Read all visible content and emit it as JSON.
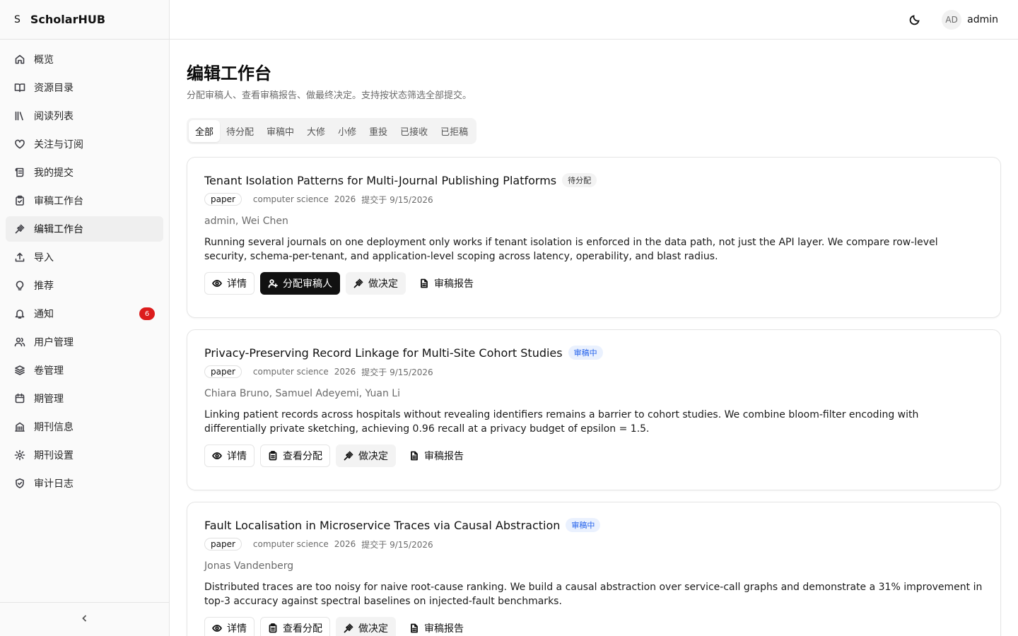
{
  "brand": {
    "mark": "S",
    "name": "ScholarHUB"
  },
  "sidebar": {
    "items": [
      {
        "label": "概览",
        "icon": "home-icon"
      },
      {
        "label": "资源目录",
        "icon": "book-open-icon"
      },
      {
        "label": "阅读列表",
        "icon": "library-icon"
      },
      {
        "label": "关注与订阅",
        "icon": "heart-icon"
      },
      {
        "label": "我的提交",
        "icon": "scroll-icon"
      },
      {
        "label": "审稿工作台",
        "icon": "clipboard-check-icon"
      },
      {
        "label": "编辑工作台",
        "icon": "gavel-icon",
        "active": true
      },
      {
        "label": "导入",
        "icon": "upload-icon"
      },
      {
        "label": "推荐",
        "icon": "lightbulb-icon"
      },
      {
        "label": "通知",
        "icon": "bell-icon",
        "badge": "6"
      },
      {
        "label": "用户管理",
        "icon": "users-icon"
      },
      {
        "label": "卷管理",
        "icon": "layers-icon"
      },
      {
        "label": "期管理",
        "icon": "calendar-icon"
      },
      {
        "label": "期刊信息",
        "icon": "building-icon"
      },
      {
        "label": "期刊设置",
        "icon": "gear-icon"
      },
      {
        "label": "审计日志",
        "icon": "shield-check-icon"
      }
    ]
  },
  "header": {
    "user_initials": "AD",
    "username": "admin"
  },
  "page": {
    "title": "编辑工作台",
    "subtitle": "分配审稿人、查看审稿报告、做最终决定。支持按状态筛选全部提交。"
  },
  "tabs": [
    "全部",
    "待分配",
    "审稿中",
    "大修",
    "小修",
    "重投",
    "已接收",
    "已拒稿"
  ],
  "actions": {
    "details": "详情",
    "assign": "分配审稿人",
    "view_assign": "查看分配",
    "decide": "做决定",
    "reports": "审稿报告"
  },
  "submissions": [
    {
      "title": "Tenant Isolation Patterns for Multi-Journal Publishing Platforms",
      "status": "待分配",
      "type": "paper",
      "field": "computer science",
      "year": "2026",
      "submitted": "提交于 9/15/2026",
      "authors": "admin, Wei Chen",
      "abstract": "Running several journals on one deployment only works if tenant isolation is enforced in the data path, not just the API layer. We compare row-level security, schema-per-tenant, and application-level scoping across latency, operability, and blast radius."
    },
    {
      "title": "Privacy-Preserving Record Linkage for Multi-Site Cohort Studies",
      "status": "审稿中",
      "type": "paper",
      "field": "computer science",
      "year": "2026",
      "submitted": "提交于 9/15/2026",
      "authors": "Chiara Bruno, Samuel Adeyemi, Yuan Li",
      "abstract": "Linking patient records across hospitals without revealing identifiers remains a barrier to cohort studies. We combine bloom-filter encoding with differentially private sketching, achieving 0.96 recall at a privacy budget of epsilon = 1.5."
    },
    {
      "title": "Fault Localisation in Microservice Traces via Causal Abstraction",
      "status": "审稿中",
      "type": "paper",
      "field": "computer science",
      "year": "2026",
      "submitted": "提交于 9/15/2026",
      "authors": "Jonas Vandenberg",
      "abstract": "Distributed traces are too noisy for naive root-cause ranking. We build a causal abstraction over service-call graphs and demonstrate a 31% improvement in top-3 accuracy against spectral baselines on injected-fault benchmarks."
    }
  ]
}
